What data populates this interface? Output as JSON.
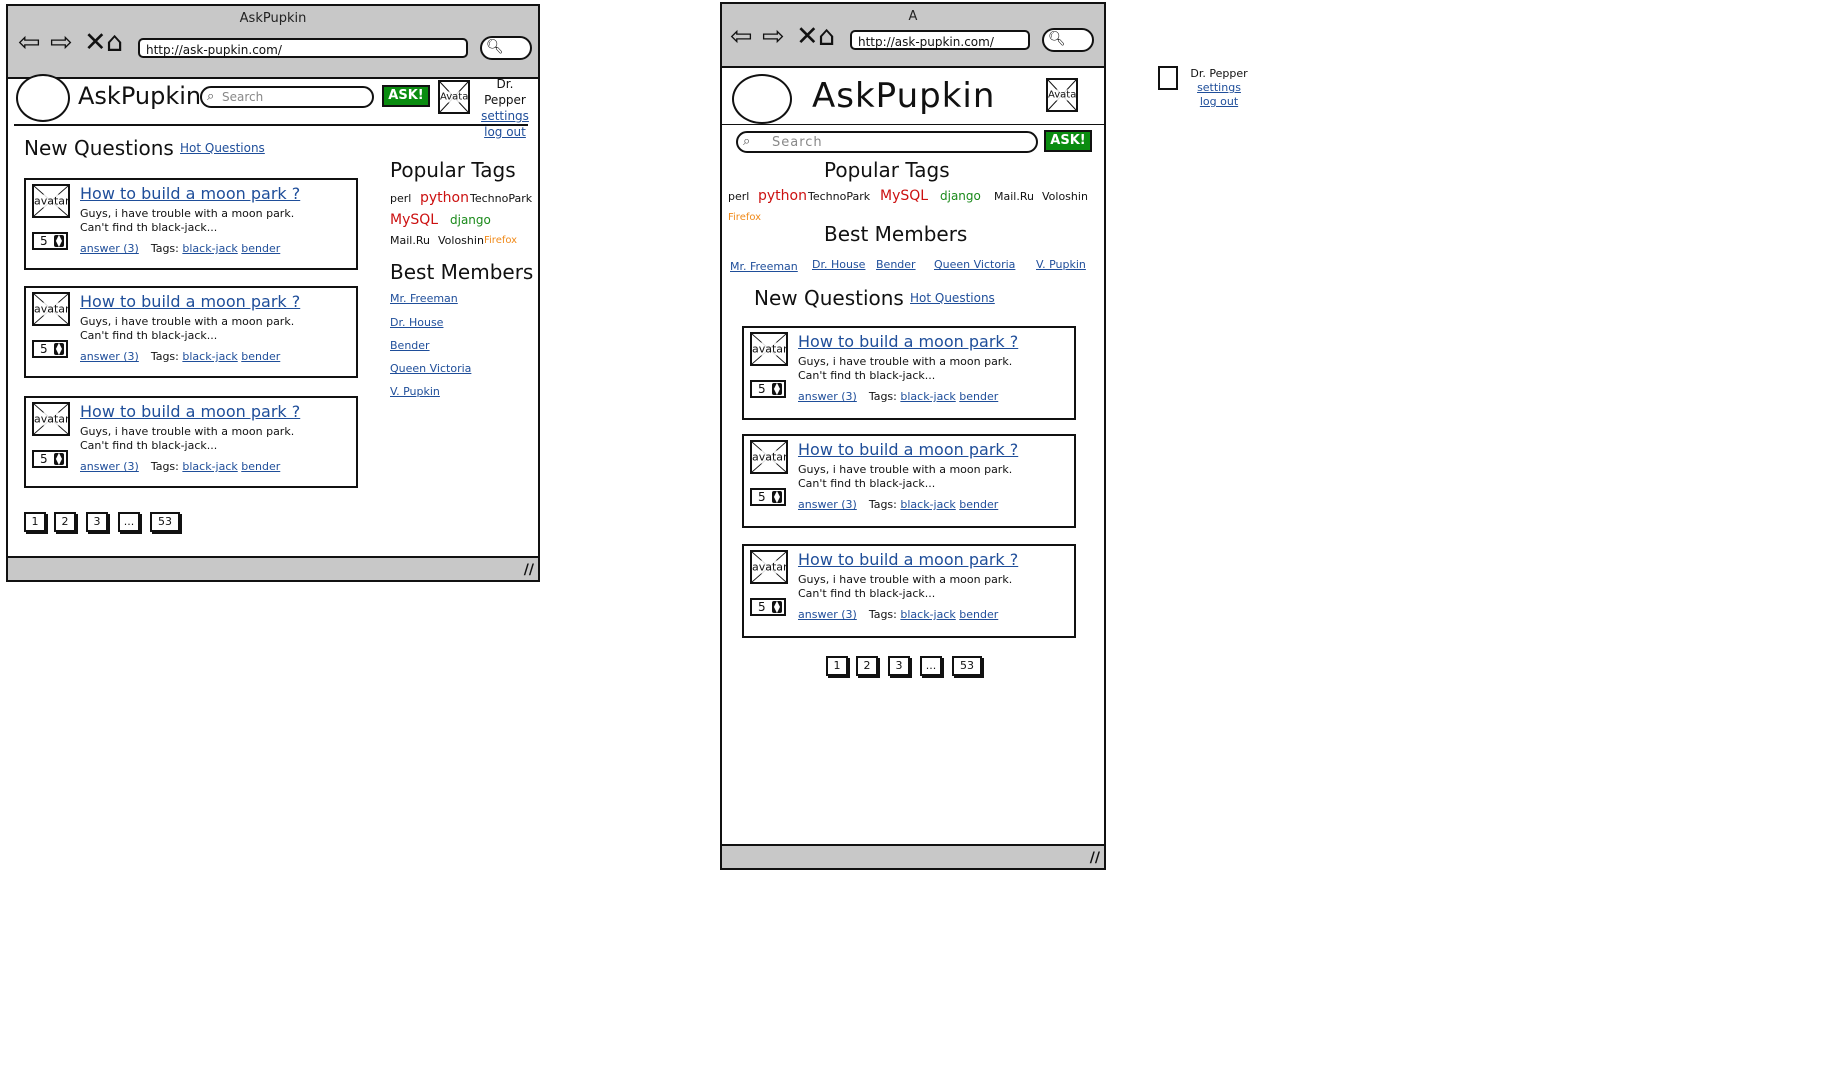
{
  "window_title_left": "AskPupkin",
  "window_title_right": "A",
  "browser": {
    "url": "http://ask-pupkin.com/",
    "back_icon": "back-arrow-icon",
    "forward_icon": "forward-arrow-icon",
    "stop_icon": "close-icon",
    "home_icon": "home-icon",
    "search_icon": "search-icon",
    "resize_grip": "//"
  },
  "header": {
    "brand": "AskPupkin",
    "search_placeholder": "Search",
    "ask_label": "ASK!",
    "avatar_label": "Avatar"
  },
  "user": {
    "name": "Dr. Pepper",
    "settings": "settings",
    "logout": "log out"
  },
  "questions_section": {
    "title": "New Questions",
    "hot_link": "Hot Questions"
  },
  "questions": [
    {
      "avatar": "avatar",
      "title": "How to build a moon park ?",
      "line1": "Guys, i have trouble with a moon park.",
      "line2": "Can't find th black-jack...",
      "votes": "5",
      "answers": "answer (3)",
      "tags_label": "Tags:",
      "tags": [
        "black-jack",
        "bender"
      ]
    },
    {
      "avatar": "avatar",
      "title": "How to build a moon park ?",
      "line1": "Guys, i have trouble with a moon park.",
      "line2": "Can't find th black-jack...",
      "votes": "5",
      "answers": "answer (3)",
      "tags_label": "Tags:",
      "tags": [
        "black-jack",
        "bender"
      ]
    },
    {
      "avatar": "avatar",
      "title": "How to build a moon park ?",
      "line1": "Guys, i have trouble with a moon park.",
      "line2": "Can't find th black-jack...",
      "votes": "5",
      "answers": "answer (3)",
      "tags_label": "Tags:",
      "tags": [
        "black-jack",
        "bender"
      ]
    }
  ],
  "pagination": [
    "1",
    "2",
    "3",
    "...",
    "53"
  ],
  "popular_tags": {
    "title": "Popular Tags",
    "tags": [
      {
        "label": "perl",
        "color": "#111111"
      },
      {
        "label": "python",
        "color": "#cc1111"
      },
      {
        "label": "TechnoPark",
        "color": "#111111"
      },
      {
        "label": "MySQL",
        "color": "#cc1111"
      },
      {
        "label": "django",
        "color": "#1a8a1a"
      },
      {
        "label": "Mail.Ru",
        "color": "#111111"
      },
      {
        "label": "Voloshin",
        "color": "#111111"
      },
      {
        "label": "Firefox",
        "color": "#f08a1a"
      }
    ]
  },
  "best_members": {
    "title": "Best Members",
    "members": [
      "Mr. Freeman",
      "Dr. House",
      "Bender",
      "Queen Victoria",
      "V. Pupkin"
    ]
  },
  "colors": {
    "chrome": "#c8c8c8",
    "link": "#1f4e9a",
    "ask_button": "#0a8c10"
  }
}
